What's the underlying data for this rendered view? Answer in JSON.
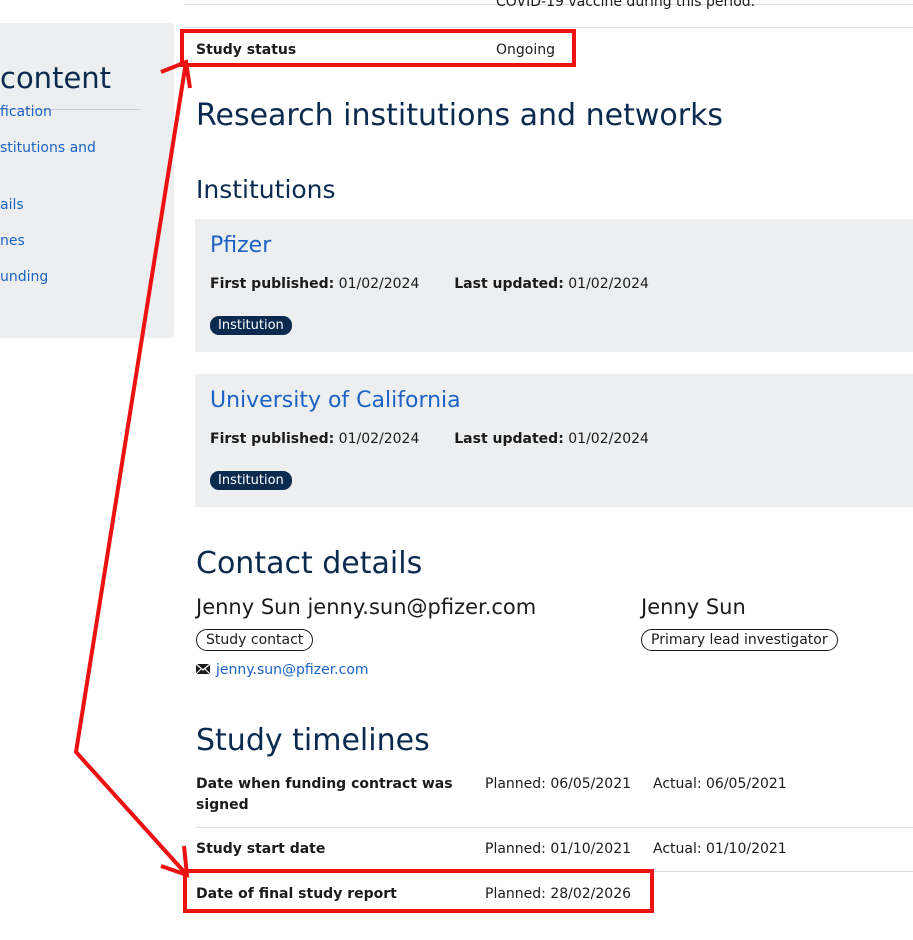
{
  "cutoff_text": "COVID-19 vaccine during this period.",
  "sidebar": {
    "title": "content",
    "items": [
      {
        "label": "fication"
      },
      {
        "label": "stitutions and"
      },
      {
        "label": "ails"
      },
      {
        "label": "nes"
      },
      {
        "label": "unding"
      }
    ]
  },
  "study_status": {
    "label": "Study status",
    "value": "Ongoing"
  },
  "research": {
    "heading": "Research institutions and networks",
    "subheading": "Institutions",
    "institutions": [
      {
        "name": "Pfizer",
        "first_published_label": "First published:",
        "first_published": "01/02/2024",
        "last_updated_label": "Last updated:",
        "last_updated": "01/02/2024",
        "badge": "Institution"
      },
      {
        "name": "University of California",
        "first_published_label": "First published:",
        "first_published": "01/02/2024",
        "last_updated_label": "Last updated:",
        "last_updated": "01/02/2024",
        "badge": "Institution"
      }
    ]
  },
  "contact": {
    "heading": "Contact details",
    "people": [
      {
        "name": "Jenny Sun jenny.sun@pfizer.com",
        "role": "Study contact",
        "email": "jenny.sun@pfizer.com"
      },
      {
        "name": "Jenny Sun",
        "role": "Primary lead investigator"
      }
    ]
  },
  "timelines": {
    "heading": "Study timelines",
    "rows": [
      {
        "label": "Date when funding contract was signed",
        "planned": "Planned: 06/05/2021",
        "actual": "Actual: 06/05/2021"
      },
      {
        "label": "Study start date",
        "planned": "Planned: 01/10/2021",
        "actual": "Actual: 01/10/2021"
      },
      {
        "label": "Date of final study report",
        "planned": "Planned: 28/02/2026",
        "actual": ""
      }
    ]
  },
  "colors": {
    "annotation": "#ee1111",
    "link": "#1b63c6",
    "heading": "#0b2a4f"
  }
}
